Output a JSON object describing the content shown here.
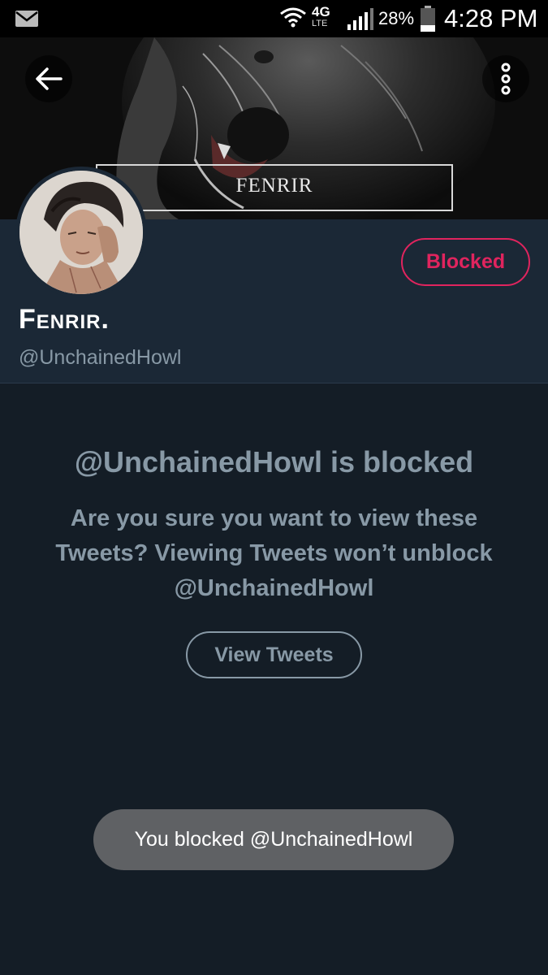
{
  "status_bar": {
    "network": "4G",
    "network_sub": "LTE",
    "battery": "28%",
    "time": "4:28 PM",
    "icons": [
      "mail-icon",
      "wifi-icon",
      "signal-icon",
      "battery-icon"
    ]
  },
  "header": {
    "banner_text": "FENRIR",
    "back_icon": "arrow-left-icon",
    "more_icon": "more-vertical-icon"
  },
  "profile": {
    "display_name": "Fenrir.",
    "handle": "@UnchainedHowl",
    "follow_state": "Blocked"
  },
  "notice": {
    "title": "@UnchainedHowl is blocked",
    "body": "Are you sure you want to view these Tweets? Viewing Tweets won’t unblock @UnchainedHowl",
    "button_label": "View Tweets"
  },
  "toast": {
    "text": "You blocked @UnchainedHowl"
  },
  "colors": {
    "background": "#141d26",
    "profile_bg": "#1b2836",
    "blocked_accent": "#e0245e",
    "muted_text": "#8899a6",
    "toast_bg": "#5f6164"
  }
}
